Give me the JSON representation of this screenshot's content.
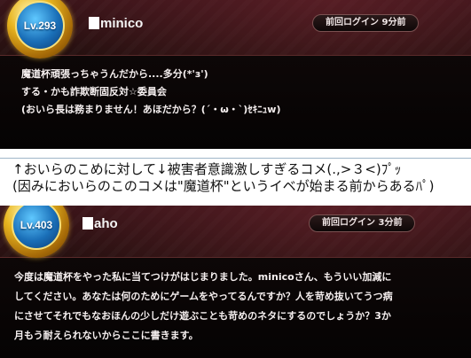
{
  "posts": [
    {
      "level": "Lv.293",
      "username": "minico",
      "last_login": "前回ログイン 9分前",
      "lines": [
        "魔道杯頑張っちゃうんだから....多分(*'з')",
        "する・かも詐欺断固反対☆委員会",
        "(おいら長は務まりません！あほだから？(´・ω・`)ｾｷﾆｭw)"
      ]
    },
    {
      "level": "Lv.403",
      "username": "aho",
      "last_login": "前回ログイン 3分前",
      "lines": [
        "今度は魔道杯をやった私に当てつけがはじまりました。minicoさん、もういい加減に",
        "してください。あなたは何のためにゲームをやってるんですか？人を苛め抜いてうつ病",
        "にさせてそれでもなおほんの少しだけ遊ぶことも苛めのネタにするのでしょうか？3か",
        "月もう耐えられないからここに書きます。"
      ]
    }
  ],
  "caption": {
    "line1": "↑おいらのこめに対して↓被害者意識激しすぎるコメ(.,>３<)ﾌﾟｯ",
    "line2": "(因みにおいらのこのコメは\"魔道杯\"というイベが始まる前からあるﾊﾟ)"
  }
}
